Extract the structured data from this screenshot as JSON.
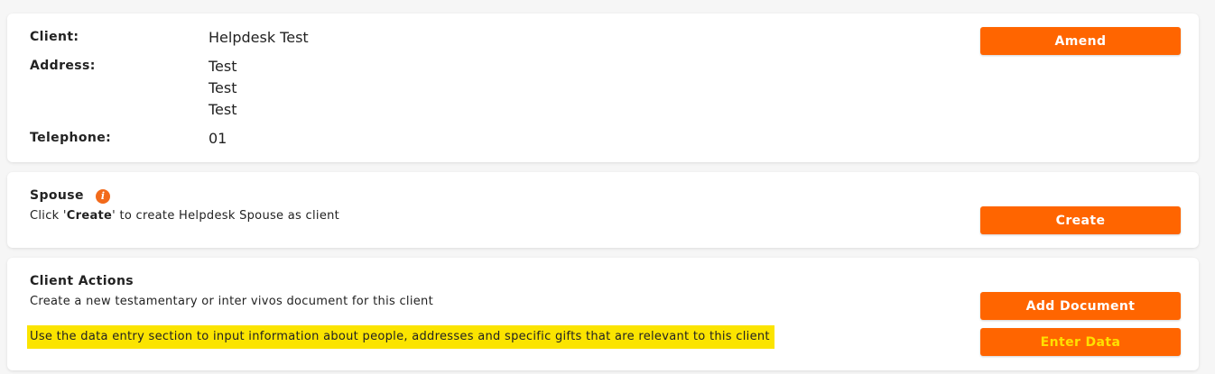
{
  "client_card": {
    "client_label": "Client:",
    "client_value": "Helpdesk Test",
    "address_label": "Address:",
    "address_lines": [
      "Test",
      "Test",
      "Test"
    ],
    "telephone_label": "Telephone:",
    "telephone_value": "01",
    "amend_label": "Amend"
  },
  "spouse_card": {
    "title": "Spouse",
    "desc_prefix": "Click '",
    "desc_bold": "Create",
    "desc_suffix": "' to create Helpdesk Spouse as client",
    "create_label": "Create",
    "info_icon": "info-icon"
  },
  "actions_card": {
    "title": "Client Actions",
    "desc": "Create a new testamentary or inter vivos document for this client",
    "highlight_text": "Use the data entry section to input information about people, addresses and specific gifts that are relevant to this client",
    "add_document_label": "Add Document",
    "enter_data_label": "Enter Data"
  },
  "colors": {
    "accent": "#ff6500",
    "highlight": "#fbe400",
    "enter_data_text": "#ffe000"
  }
}
